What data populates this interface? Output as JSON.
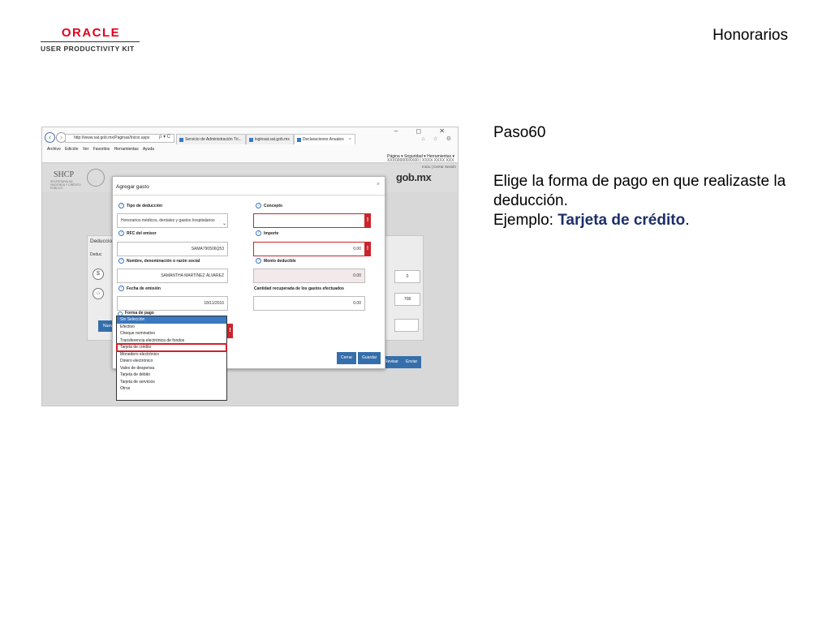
{
  "logo": {
    "brand": "ORACLE",
    "product": "USER PRODUCTIVITY KIT"
  },
  "document_title": "Honorarios",
  "step_label": "Paso60",
  "instruction": {
    "line1": "Elige la forma de pago en que realizaste la deducción.",
    "example_prefix": "Ejemplo: ",
    "example_value": "Tarjeta de crédito",
    "example_suffix": "."
  },
  "browser": {
    "window_controls": "–  ◻  ✕",
    "address": "http://www.sat.gob.mx/Paginas/Inicio.aspx",
    "address_icons": "ρ ▾ C",
    "tabs": [
      {
        "label": "Servicio de Administración Tri...",
        "active": false
      },
      {
        "label": "loginsat.sat.gob.mx",
        "active": false
      },
      {
        "label": "Declaraciones Anuales",
        "active": true
      }
    ],
    "menu": "Archivo Edición Ver Favoritos Herramientas Ayuda",
    "toolbar": "Página ▾  Seguridad ▾  Herramientas ▾",
    "side_icons": "⌂ ☆ ⚙"
  },
  "site": {
    "agency": "SHCP",
    "agency_sub": "SECRETARÍA DE HACIENDA Y CRÉDITO PÚBLICO",
    "portal": "gob.mx",
    "rfc": "XXX000000XX00  |  XXXX XXXX XXX",
    "session_links": "Inicio | Cerrar Sesión"
  },
  "background_panel": {
    "title": "Deducciones",
    "item": "Deduc",
    "values": [
      "0",
      "708"
    ],
    "nuevo_label": "Nuevo",
    "revisar_label": "Revisar",
    "enviar_label": "Enviar"
  },
  "modal": {
    "title": "Agregar gasto",
    "close": "×",
    "fields": {
      "tipo_deduccion": {
        "label": "Tipo de deducción",
        "value": "Honorarios médicos, dentales y gastos hospitalarios"
      },
      "concepto": {
        "label": "Concepto",
        "value": ""
      },
      "rfc_emisor": {
        "label": "RFC del emisor",
        "value": "SAMA790506Q53"
      },
      "importe": {
        "label": "Importe",
        "value": "0.00"
      },
      "nombre": {
        "label": "Nombre, denominación o razón social",
        "value": "SAMANTHA MARTÍNEZ ÁLVAREZ"
      },
      "monto_deducible": {
        "label": "Monto deducible",
        "value": "0.00"
      },
      "fecha_emision": {
        "label": "Fecha de emisión",
        "value": "18/11/2016"
      },
      "cantidad_recuperada": {
        "label": "Cantidad recuperada de los gastos efectuados",
        "value": "0.00"
      },
      "forma_pago": {
        "label": "Forma de pago"
      }
    },
    "error_mark": "!",
    "cerrar_label": "Cerrar",
    "guardar_label": "Guardar"
  },
  "forma_pago_options": [
    "Sin Selección",
    "Efectivo",
    "Cheque nominativo",
    "Transferencia electrónica de fondos",
    "Tarjeta de crédito",
    "Monedero electrónico",
    "Dinero electrónico",
    "Vales de despensa",
    "Tarjeta de débito",
    "Tarjeta de servicios",
    "Otros"
  ],
  "forma_pago_selected": "Sin Selección",
  "forma_pago_target": "Tarjeta de crédito",
  "colors": {
    "oracle_red": "#e3001b",
    "highlight_blue": "#1c2e6b",
    "error_red": "#c9252c",
    "button_blue": "#356fab",
    "selection_blue": "#3a78c0"
  }
}
